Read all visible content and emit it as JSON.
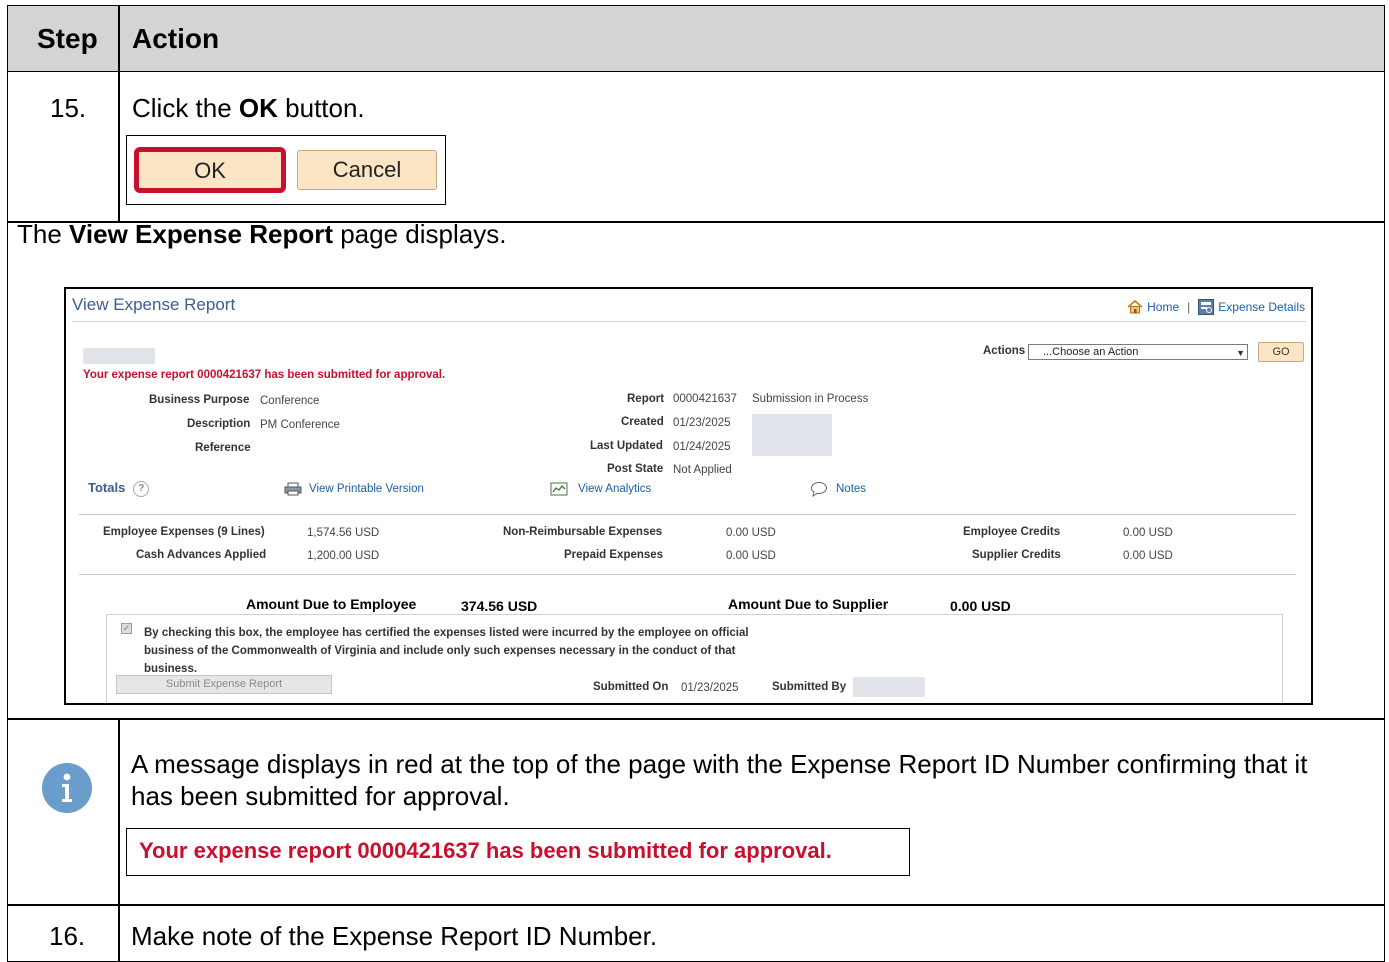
{
  "header": {
    "step": "Step",
    "action": "Action"
  },
  "step15": {
    "number": "15.",
    "text_pre": "Click the ",
    "text_bold": "OK",
    "text_post": " button.",
    "ok_label": "OK",
    "cancel_label": "Cancel"
  },
  "display_line": {
    "pre": "The ",
    "bold": "View Expense Report",
    "post": " page displays."
  },
  "screenshot": {
    "title": "View Expense Report",
    "home_link": "Home",
    "separator": "|",
    "expense_details_link": "Expense Details",
    "actions_label": "Actions",
    "actions_select": "...Choose an Action",
    "go_label": "GO",
    "message": "Your expense report 0000421637 has been submitted for approval.",
    "business_purpose_label": "Business Purpose",
    "business_purpose_value": "Conference",
    "description_label": "Description",
    "description_value": "PM Conference",
    "reference_label": "Reference",
    "report_label": "Report",
    "report_value": "0000421637",
    "report_status": "Submission in Process",
    "created_label": "Created",
    "created_value": "01/23/2025",
    "last_updated_label": "Last Updated",
    "last_updated_value": "01/24/2025",
    "post_state_label": "Post State",
    "post_state_value": "Not Applied",
    "totals_label": "Totals",
    "help_icon": "?",
    "printable_link": "View Printable Version",
    "analytics_link": "View Analytics",
    "notes_link": "Notes",
    "employee_expenses_label": "Employee Expenses (9 Lines)",
    "employee_expenses_value": "1,574.56  USD",
    "cash_advances_label": "Cash Advances Applied",
    "cash_advances_value": "1,200.00  USD",
    "non_reimb_label": "Non-Reimbursable Expenses",
    "non_reimb_value": "0.00  USD",
    "prepaid_label": "Prepaid Expenses",
    "prepaid_value": "0.00  USD",
    "employee_credits_label": "Employee Credits",
    "employee_credits_value": "0.00  USD",
    "supplier_credits_label": "Supplier Credits",
    "supplier_credits_value": "0.00  USD",
    "amount_due_employee_label": "Amount Due to Employee",
    "amount_due_employee_value": "374.56  USD",
    "amount_due_supplier_label": "Amount Due to Supplier",
    "amount_due_supplier_value": "0.00  USD",
    "checkbox_mark": "✓",
    "certification_text": "By checking this box, the employee has certified the expenses listed were incurred by the employee on official business of the Commonwealth of Virginia and include only such expenses necessary in the conduct of that business.",
    "submit_button": "Submit Expense Report",
    "submitted_on_label": "Submitted On",
    "submitted_on_value": "01/23/2025",
    "submitted_by_label": "Submitted By"
  },
  "info": {
    "icon": "info-icon",
    "text": "A message displays in red at the top of the page with the Expense Report ID Number confirming that it has been submitted for approval.",
    "banner": "Your expense report 0000421637 has been submitted for approval."
  },
  "step16": {
    "number": "16.",
    "text": "Make note of the Expense Report ID Number."
  },
  "colors": {
    "header_bg": "#d4d4d4",
    "red": "#c8102e",
    "link": "#1c5fa8",
    "info_icon": "#6a9ccc",
    "button_bg": "#fbe5c5"
  }
}
